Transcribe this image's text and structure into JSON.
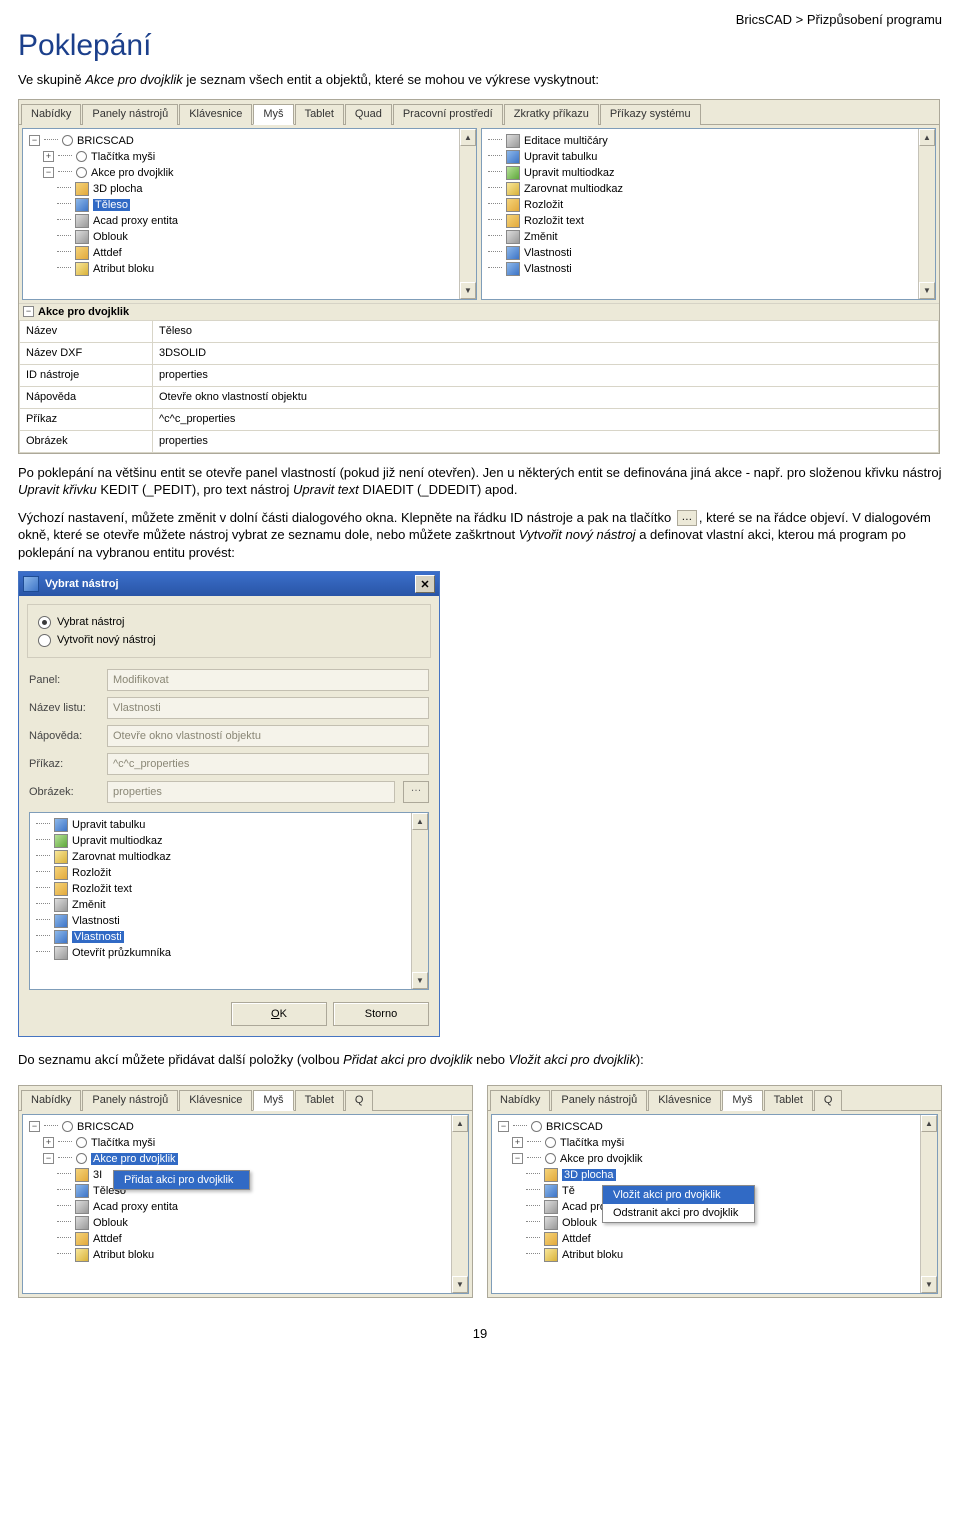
{
  "breadcrumb": "BricsCAD > Přizpůsobení programu",
  "heading": "Poklepání",
  "intro_a": "Ve skupině ",
  "intro_i1": "Akce pro dvojklik",
  "intro_b": " je seznam všech entit a objektů, které se mohou ve výkrese vyskytnout:",
  "tabs": [
    "Nabídky",
    "Panely nástrojů",
    "Klávesnice",
    "Myš",
    "Tablet",
    "Quad",
    "Pracovní prostředí",
    "Zkratky příkazu",
    "Příkazy systému"
  ],
  "active_tab": "Myš",
  "tree_left": {
    "root": "BRICSCAD",
    "mouse_buttons": "Tlačítka myši",
    "dblclick": "Akce pro dvojklik",
    "items": [
      "3D plocha",
      "Těleso",
      "Acad proxy entita",
      "Oblouk",
      "Attdef",
      "Atribut bloku"
    ],
    "selected": "Těleso"
  },
  "tree_right": {
    "items": [
      "Editace multičáry",
      "Upravit tabulku",
      "Upravit multiodkaz",
      "Zarovnat multiodkaz",
      "Rozložit",
      "Rozložit text",
      "Změnit",
      "Vlastnosti",
      "Vlastnosti"
    ]
  },
  "propgrid": {
    "header": "Akce pro dvojklik",
    "rows": [
      {
        "k": "Název",
        "v": "Těleso"
      },
      {
        "k": "Název DXF",
        "v": "3DSOLID"
      },
      {
        "k": "ID nástroje",
        "v": "properties"
      },
      {
        "k": "Nápověda",
        "v": "Otevře okno vlastností objektu"
      },
      {
        "k": "Příkaz",
        "v": "^c^c_properties"
      },
      {
        "k": "Obrázek",
        "v": "properties"
      }
    ]
  },
  "para2_a": "Po poklepání na většinu entit se otevře panel vlastností (pokud již není otevřen). Jen u některých entit se definována jiná akce - např. pro složenou křivku nástroj ",
  "para2_i1": "Upravit křivku",
  "para2_b": " KEDIT (_PEDIT), pro text nástroj ",
  "para2_i2": "Upravit text",
  "para2_c": " DIAEDIT (_DDEDIT) apod.",
  "para3_a": "Výchozí nastavení, můžete změnit v dolní části dialogového okna. Klepněte na řádku ID nástroje a pak na tlačítko ",
  "para3_btn": "…",
  "para3_b": ", které se na řádce objeví. V dialogovém okně, které se otevře můžete nástroj vybrat ze seznamu dole, nebo můžete zaškrtnout ",
  "para3_i1": "Vytvořit nový nástroj",
  "para3_c": " a definovat vlastní akci, kterou má program po poklepání na vybranou entitu provést:",
  "dialog": {
    "title": "Vybrat nástroj",
    "radio1": "Vybrat nástroj",
    "radio2": "Vytvořit nový nástroj",
    "fields": {
      "panel": {
        "label": "Panel:",
        "value": "Modifikovat"
      },
      "list": {
        "label": "Název listu:",
        "value": "Vlastnosti"
      },
      "help": {
        "label": "Nápověda:",
        "value": "Otevře okno vlastností objektu"
      },
      "cmd": {
        "label": "Příkaz:",
        "value": "^c^c_properties"
      },
      "image": {
        "label": "Obrázek:",
        "value": "properties"
      }
    },
    "list_items": [
      "Upravit tabulku",
      "Upravit multiodkaz",
      "Zarovnat multiodkaz",
      "Rozložit",
      "Rozložit text",
      "Změnit",
      "Vlastnosti",
      "Vlastnosti",
      "Otevřít průzkumníka"
    ],
    "selected_item": "Vlastnosti",
    "ok": "OK",
    "cancel": "Storno"
  },
  "para4_a": "Do seznamu akcí můžete přidávat další položky (volbou ",
  "para4_i1": "Přidat akci pro dvojklik",
  "para4_b": " nebo ",
  "para4_i2": "Vložit akci pro dvojklik",
  "para4_c": "):",
  "panelB": {
    "tabs_short": [
      "Nabídky",
      "Panely nástrojů",
      "Klávesnice",
      "Myš",
      "Tablet",
      "Q"
    ],
    "root": "BRICSCAD",
    "mouse_buttons": "Tlačítka myši",
    "dblclick": "Akce pro dvojklik",
    "items": [
      "3D plocha",
      "Těleso",
      "Acad proxy entita",
      "Oblouk",
      "Attdef",
      "Atribut bloku"
    ],
    "selected": "Akce pro dvojklik",
    "menu": [
      "Přidat akci pro dvojklik"
    ],
    "first_vis": "3I"
  },
  "panelC": {
    "root": "BRICSCAD",
    "mouse_buttons": "Tlačítka myši",
    "dblclick": "Akce pro dvojklik",
    "items": [
      "3D plocha",
      "Těleso",
      "Acad proxy entita",
      "Oblouk",
      "Attdef",
      "Atribut bloku"
    ],
    "selected": "3D plocha",
    "menu": [
      "Vložit akci pro dvojklik",
      "Odstranit akci pro dvojklik"
    ],
    "first_cut": "Tě"
  },
  "page": "19"
}
